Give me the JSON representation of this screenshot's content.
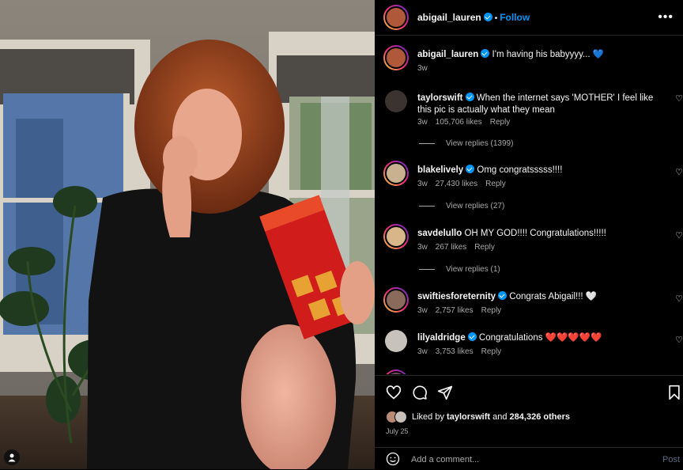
{
  "header": {
    "username": "abigail_lauren",
    "dot": "•",
    "follow_label": "Follow",
    "more_icon": "more-horizontal-icon"
  },
  "caption": {
    "username": "abigail_lauren",
    "text": "I'm having his babyyyy... 💙",
    "time": "3w"
  },
  "comments": [
    {
      "username": "taylorswift",
      "text": "When the internet says 'MOTHER' I feel like this pic is actually what they mean",
      "time": "3w",
      "likes": "105,706 likes",
      "reply": "Reply",
      "view_replies": "View replies (1399)"
    },
    {
      "username": "blakelively",
      "text": "Omg congratsssss!!!!",
      "time": "3w",
      "likes": "27,430 likes",
      "reply": "Reply",
      "view_replies": "View replies (27)"
    },
    {
      "username": "savdelullo",
      "text": "OH MY GOD!!!! Congratulations!!!!!",
      "time": "3w",
      "likes": "267 likes",
      "reply": "Reply",
      "view_replies": "View replies (1)"
    },
    {
      "username": "swiftiesforeternity",
      "text": "Congrats Abigail!!! 🤍",
      "time": "3w",
      "likes": "2,757 likes",
      "reply": "Reply"
    },
    {
      "username": "lilyaldridge",
      "text": "Congratulations ❤️❤️❤️❤️❤️",
      "time": "3w",
      "likes": "3,753 likes",
      "reply": "Reply"
    }
  ],
  "actions": {
    "liked_prefix": "Liked by",
    "liked_user": "taylorswift",
    "liked_mid": "and",
    "liked_count": "284,326 others",
    "date": "July 25"
  },
  "add_comment": {
    "placeholder": "Add a comment...",
    "post_label": "Post"
  },
  "colors": {
    "accent": "#0095f6",
    "heart_blue": "#1877f2",
    "heart_red": "#ed4956"
  }
}
